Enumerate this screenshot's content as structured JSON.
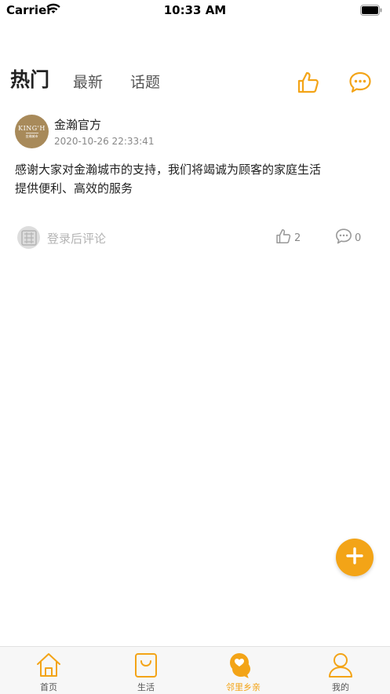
{
  "status_bar": {
    "carrier": "Carrier",
    "time": "10:33 AM"
  },
  "tabs": {
    "hot": "热门",
    "latest": "最新",
    "topics": "话题"
  },
  "post": {
    "avatar_text": "KING'H",
    "avatar_subtext": "金瀚城市",
    "author": "金瀚官方",
    "time": "2020-10-26 22:33:41",
    "content": "感谢大家对金瀚城市的支持，我们将竭诚为顾客的家庭生活提供便利、高效的服务",
    "comment_placeholder": "登录后评论",
    "like_count": "2",
    "comment_count": "0"
  },
  "colors": {
    "accent": "#f3a417",
    "gold": "#a88a5a"
  },
  "bottom_nav": [
    {
      "label": "首页",
      "icon": "home-icon"
    },
    {
      "label": "生活",
      "icon": "shopping-bag-icon"
    },
    {
      "label": "邻里乡亲",
      "icon": "neighbors-chat-icon",
      "active": true
    },
    {
      "label": "我的",
      "icon": "profile-icon"
    }
  ]
}
